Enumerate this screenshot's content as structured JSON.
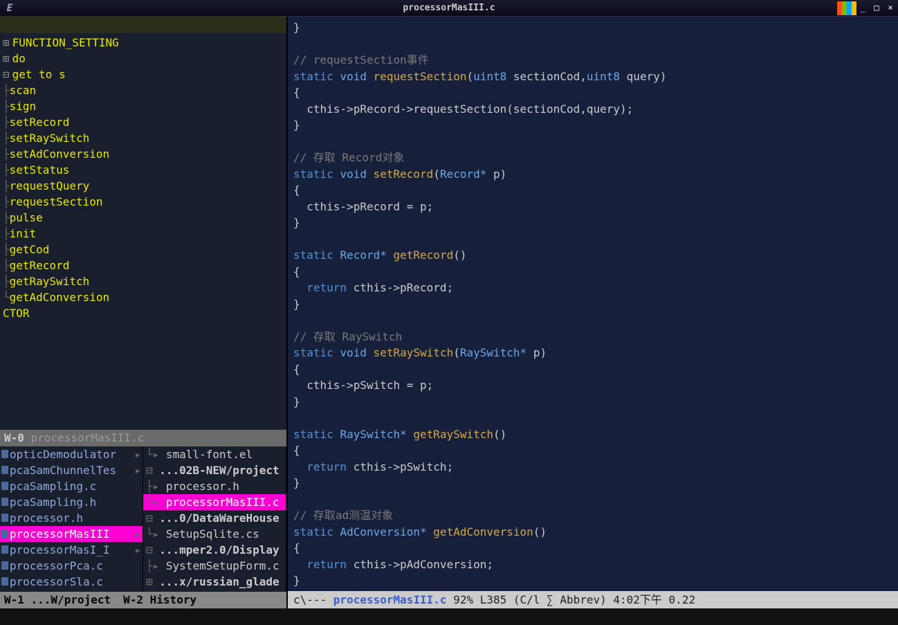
{
  "window": {
    "title": "processorMasIII.c",
    "app_icon": "E"
  },
  "outline": {
    "items": [
      {
        "marker": "⊞",
        "label": "FUNCTION_SETTING",
        "indent": 0
      },
      {
        "marker": "⊞",
        "label": "do",
        "indent": 0
      },
      {
        "marker": "⊟",
        "label": "get to s",
        "indent": 0
      },
      {
        "marker": "├",
        "label": "scan",
        "indent": 1
      },
      {
        "marker": "├",
        "label": "sign",
        "indent": 1
      },
      {
        "marker": "├",
        "label": "setRecord",
        "indent": 1
      },
      {
        "marker": "├",
        "label": "setRaySwitch",
        "indent": 1
      },
      {
        "marker": "├",
        "label": "setAdConversion",
        "indent": 1
      },
      {
        "marker": "├",
        "label": "setStatus",
        "indent": 1
      },
      {
        "marker": "├",
        "label": "requestQuery",
        "indent": 1
      },
      {
        "marker": "├",
        "label": "requestSection",
        "indent": 1
      },
      {
        "marker": "├",
        "label": "pulse",
        "indent": 1
      },
      {
        "marker": "├",
        "label": "init",
        "indent": 1
      },
      {
        "marker": "├",
        "label": "getCod",
        "indent": 1
      },
      {
        "marker": "├",
        "label": "getRecord",
        "indent": 1
      },
      {
        "marker": "├",
        "label": "getRaySwitch",
        "indent": 1
      },
      {
        "marker": "└",
        "label": "getAdConversion",
        "indent": 1
      },
      {
        "marker": "",
        "label": "CTOR",
        "indent": 0
      }
    ],
    "modeline_left": "W-0",
    "modeline_buf": "processorMasIII.c"
  },
  "files_left": [
    {
      "label": "opticDemodulator",
      "arrow": true,
      "sel": false
    },
    {
      "label": "pcaSamChunnelTes",
      "arrow": true,
      "sel": false
    },
    {
      "label": "pcaSampling.c",
      "arrow": false,
      "sel": false
    },
    {
      "label": "pcaSampling.h",
      "arrow": false,
      "sel": false
    },
    {
      "label": "processor.h",
      "arrow": false,
      "sel": false
    },
    {
      "label": "processorMasIII",
      "arrow": true,
      "sel": true
    },
    {
      "label": "processorMasI_I",
      "arrow": true,
      "sel": false
    },
    {
      "label": "processorPca.c",
      "arrow": false,
      "sel": false
    },
    {
      "label": "processorSla.c",
      "arrow": false,
      "sel": false
    }
  ],
  "files_right": [
    {
      "branch": "└▸",
      "label": "small-font.el",
      "dir": false,
      "sel": false,
      "bold": false
    },
    {
      "branch": "⊟",
      "label": "...02B-NEW/project",
      "dir": true,
      "sel": false,
      "bold": true
    },
    {
      "branch": " ├▸",
      "label": "processor.h",
      "dir": false,
      "sel": false,
      "bold": false
    },
    {
      "branch": " └▸",
      "label": "processorMasIII.c",
      "dir": false,
      "sel": true,
      "bold": false
    },
    {
      "branch": "⊟",
      "label": "...0/DataWareHouse",
      "dir": true,
      "sel": false,
      "bold": true
    },
    {
      "branch": " └▸",
      "label": "SetupSqlite.cs",
      "dir": false,
      "sel": false,
      "bold": false
    },
    {
      "branch": "⊟",
      "label": "...mper2.0/Display",
      "dir": true,
      "sel": false,
      "bold": true
    },
    {
      "branch": " ├▸",
      "label": "SystemSetupForm.c",
      "dir": false,
      "sel": false,
      "bold": false
    },
    {
      "branch": "⊞",
      "label": "...x/russian_glade",
      "dir": true,
      "sel": false,
      "bold": true
    }
  ],
  "bottom_modeline": {
    "left": "W-1 ...W/project",
    "right": "W-2 History"
  },
  "code": {
    "lines": [
      {
        "t": "}",
        "c": "pn"
      },
      {
        "t": ""
      },
      {
        "t": "// requestSection事件",
        "c": "cm"
      },
      {
        "spans": [
          {
            "t": "static ",
            "c": "kw"
          },
          {
            "t": "void ",
            "c": "ty"
          },
          {
            "t": "requestSection",
            "c": "fn"
          },
          {
            "t": "(",
            "c": "pn"
          },
          {
            "t": "uint8 ",
            "c": "ty"
          },
          {
            "t": "sectionCod",
            "c": "va"
          },
          {
            "t": ",",
            "c": "pn"
          },
          {
            "t": "uint8 ",
            "c": "ty"
          },
          {
            "t": "query",
            "c": "va"
          },
          {
            "t": ")",
            "c": "pn"
          }
        ]
      },
      {
        "t": "{",
        "c": "pn"
      },
      {
        "t": "  cthis->pRecord->requestSection(sectionCod,query);",
        "c": "va"
      },
      {
        "t": "}",
        "c": "pn"
      },
      {
        "t": ""
      },
      {
        "t": "// 存取 Record对象",
        "c": "cm"
      },
      {
        "spans": [
          {
            "t": "static ",
            "c": "kw"
          },
          {
            "t": "void ",
            "c": "ty"
          },
          {
            "t": "setRecord",
            "c": "fn"
          },
          {
            "t": "(",
            "c": "pn"
          },
          {
            "t": "Record* ",
            "c": "ty"
          },
          {
            "t": "p",
            "c": "va"
          },
          {
            "t": ")",
            "c": "pn"
          }
        ]
      },
      {
        "t": "{",
        "c": "pn"
      },
      {
        "t": "  cthis->pRecord = p;",
        "c": "va"
      },
      {
        "t": "}",
        "c": "pn"
      },
      {
        "t": ""
      },
      {
        "spans": [
          {
            "t": "static ",
            "c": "kw"
          },
          {
            "t": "Record* ",
            "c": "ty"
          },
          {
            "t": "getRecord",
            "c": "fn"
          },
          {
            "t": "()",
            "c": "pn"
          }
        ]
      },
      {
        "t": "{",
        "c": "pn"
      },
      {
        "spans": [
          {
            "t": "  ",
            "c": "pn"
          },
          {
            "t": "return ",
            "c": "kw"
          },
          {
            "t": "cthis->pRecord;",
            "c": "va"
          }
        ]
      },
      {
        "t": "}",
        "c": "pn"
      },
      {
        "t": ""
      },
      {
        "t": "// 存取 RaySwitch",
        "c": "cm"
      },
      {
        "spans": [
          {
            "t": "static ",
            "c": "kw"
          },
          {
            "t": "void ",
            "c": "ty"
          },
          {
            "t": "setRaySwitch",
            "c": "fn"
          },
          {
            "t": "(",
            "c": "pn"
          },
          {
            "t": "RaySwitch* ",
            "c": "ty"
          },
          {
            "t": "p",
            "c": "va"
          },
          {
            "t": ")",
            "c": "pn"
          }
        ]
      },
      {
        "t": "{",
        "c": "pn"
      },
      {
        "t": "  cthis->pSwitch = p;",
        "c": "va"
      },
      {
        "t": "}",
        "c": "pn"
      },
      {
        "t": ""
      },
      {
        "spans": [
          {
            "t": "static ",
            "c": "kw"
          },
          {
            "t": "RaySwitch* ",
            "c": "ty"
          },
          {
            "t": "getRaySwitch",
            "c": "fn"
          },
          {
            "t": "()",
            "c": "pn"
          }
        ]
      },
      {
        "t": "{",
        "c": "pn"
      },
      {
        "spans": [
          {
            "t": "  ",
            "c": "pn"
          },
          {
            "t": "return ",
            "c": "kw"
          },
          {
            "t": "cthis->pSwitch;",
            "c": "va"
          }
        ]
      },
      {
        "t": "}",
        "c": "pn"
      },
      {
        "t": ""
      },
      {
        "t": "// 存取ad测温对象",
        "c": "cm"
      },
      {
        "spans": [
          {
            "t": "static ",
            "c": "kw"
          },
          {
            "t": "AdConversion* ",
            "c": "ty"
          },
          {
            "t": "getAdConversion",
            "c": "fn"
          },
          {
            "t": "()",
            "c": "pn"
          }
        ]
      },
      {
        "t": "{",
        "c": "pn"
      },
      {
        "spans": [
          {
            "t": "  ",
            "c": "pn"
          },
          {
            "t": "return ",
            "c": "kw"
          },
          {
            "t": "cthis->pAdConversion;",
            "c": "va"
          }
        ]
      },
      {
        "t": "}",
        "c": "pn"
      }
    ],
    "modeline": {
      "prefix": "c\\---  ",
      "buf": "processorMasIII.c",
      "pos": "   92% L385   ",
      "mode": "(C/l ∑ Abbrev) 4:02下午 0.22"
    }
  }
}
